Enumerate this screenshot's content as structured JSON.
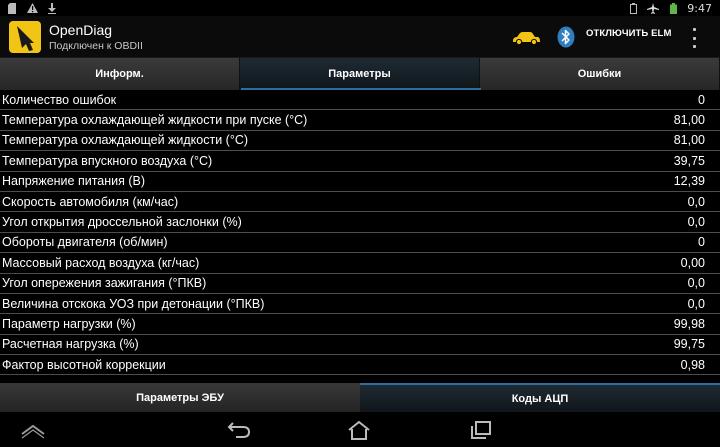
{
  "status_bar": {
    "time": "9:47",
    "left_icons": [
      "sd-card-icon",
      "warning-icon",
      "download-icon"
    ],
    "right_icons": [
      "battery-saver-icon",
      "airplane-mode-icon",
      "battery-icon"
    ]
  },
  "app": {
    "title": "OpenDiag",
    "subtitle": "Подключен к OBDII",
    "disconnect_label": "ОТКЛЮЧИТЬ ELM"
  },
  "tabs": [
    {
      "label": "Информ.",
      "active": false
    },
    {
      "label": "Параметры",
      "active": true
    },
    {
      "label": "Ошибки",
      "active": false
    }
  ],
  "params": [
    {
      "name": "Количество ошибок",
      "value": "0"
    },
    {
      "name": "Температура охлаждающей жидкости при пуске (°C)",
      "value": "81,00"
    },
    {
      "name": "Температура охлаждающей жидкости (°C)",
      "value": "81,00"
    },
    {
      "name": "Температура впускного воздуха (°C)",
      "value": "39,75"
    },
    {
      "name": "Напряжение питания (В)",
      "value": "12,39"
    },
    {
      "name": "Скорость автомобиля (км/час)",
      "value": "0,0"
    },
    {
      "name": "Угол открытия дроссельной заслонки (%)",
      "value": "0,0"
    },
    {
      "name": "Обороты двигателя (об/мин)",
      "value": "0"
    },
    {
      "name": "Массовый расход воздуха (кг/час)",
      "value": "0,00"
    },
    {
      "name": "Угол опережения зажигания (°ПКВ)",
      "value": "0,0"
    },
    {
      "name": "Величина отскока УОЗ при детонации (°ПКВ)",
      "value": "0,0"
    },
    {
      "name": "Параметр нагрузки (%)",
      "value": "99,98"
    },
    {
      "name": "Расчетная нагрузка (%)",
      "value": "99,75"
    },
    {
      "name": "Фактор высотной коррекции",
      "value": "0,98"
    },
    {
      "name": "",
      "value": ""
    }
  ],
  "bottom_tabs": [
    {
      "label": "Параметры ЭБУ",
      "active": false
    },
    {
      "label": "Коды АЦП",
      "active": true
    }
  ],
  "colors": {
    "accent": "#2d6e9c",
    "app_icon_bg": "#f2c414",
    "car_icon": "#f2c414",
    "bluetooth_icon": "#cfd8e0"
  }
}
